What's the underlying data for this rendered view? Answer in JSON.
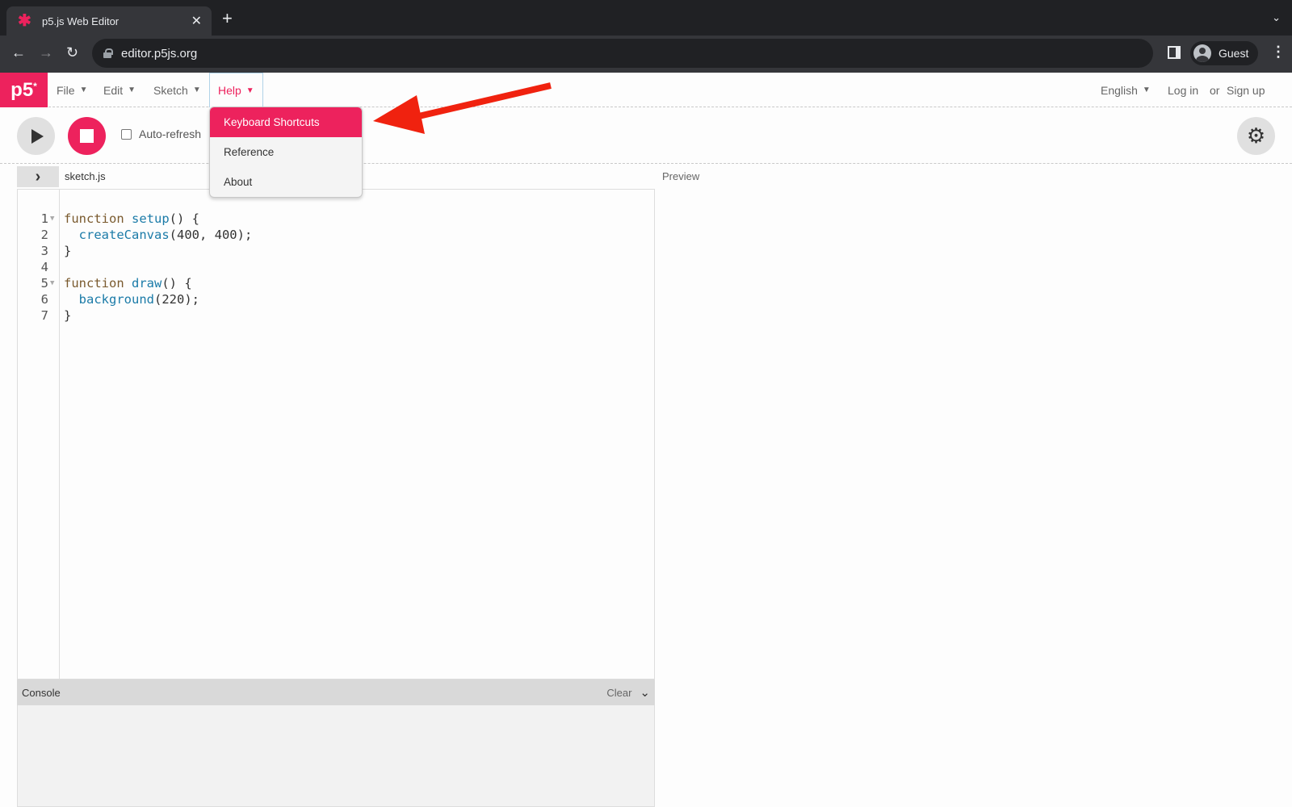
{
  "browser": {
    "tab_title": "p5.js Web Editor",
    "tab_close": "✕",
    "new_tab": "+",
    "tab_list": "⌄",
    "back": "←",
    "forward": "→",
    "reload": "↻",
    "url": "editor.p5js.org",
    "profile_label": "Guest",
    "menu": "⋮"
  },
  "app": {
    "logo": "p5",
    "logo_mark": "*",
    "accent_color": "#ed225d",
    "menus": [
      {
        "label": "File",
        "caret": "▼"
      },
      {
        "label": "Edit",
        "caret": "▼"
      },
      {
        "label": "Sketch",
        "caret": "▼"
      },
      {
        "label": "Help",
        "caret": "▼"
      }
    ],
    "language": "English",
    "language_caret": "▼",
    "login": "Log in",
    "or": "or",
    "signup": "Sign up"
  },
  "help_dropdown": {
    "items": [
      "Keyboard Shortcuts",
      "Reference",
      "About"
    ]
  },
  "toolbar": {
    "auto_refresh_label": "Auto-refresh",
    "auto_refresh_checked": false,
    "settings_icon": "⚙"
  },
  "editor": {
    "sidebar_toggle": "›",
    "file_name": "sketch.js",
    "preview_label": "Preview",
    "lines": [
      {
        "n": "1",
        "fold": "▼",
        "parts": [
          [
            "kw",
            "function "
          ],
          [
            "fn",
            "setup"
          ],
          [
            "",
            "() {"
          ]
        ]
      },
      {
        "n": "2",
        "fold": "",
        "parts": [
          [
            "",
            "  "
          ],
          [
            "fn",
            "createCanvas"
          ],
          [
            "",
            "(400, 400);"
          ]
        ]
      },
      {
        "n": "3",
        "fold": "",
        "parts": [
          [
            "",
            "}"
          ]
        ]
      },
      {
        "n": "4",
        "fold": "",
        "parts": [
          [
            "",
            ""
          ]
        ]
      },
      {
        "n": "5",
        "fold": "▼",
        "parts": [
          [
            "kw",
            "function "
          ],
          [
            "fn",
            "draw"
          ],
          [
            "",
            "() {"
          ]
        ]
      },
      {
        "n": "6",
        "fold": "",
        "parts": [
          [
            "",
            "  "
          ],
          [
            "fn",
            "background"
          ],
          [
            "",
            "(220);"
          ]
        ]
      },
      {
        "n": "7",
        "fold": "",
        "parts": [
          [
            "",
            "}"
          ]
        ]
      }
    ]
  },
  "console": {
    "title": "Console",
    "clear": "Clear",
    "collapse_icon": "⌄"
  },
  "annotation": {
    "arrow_color": "#f0220f"
  }
}
